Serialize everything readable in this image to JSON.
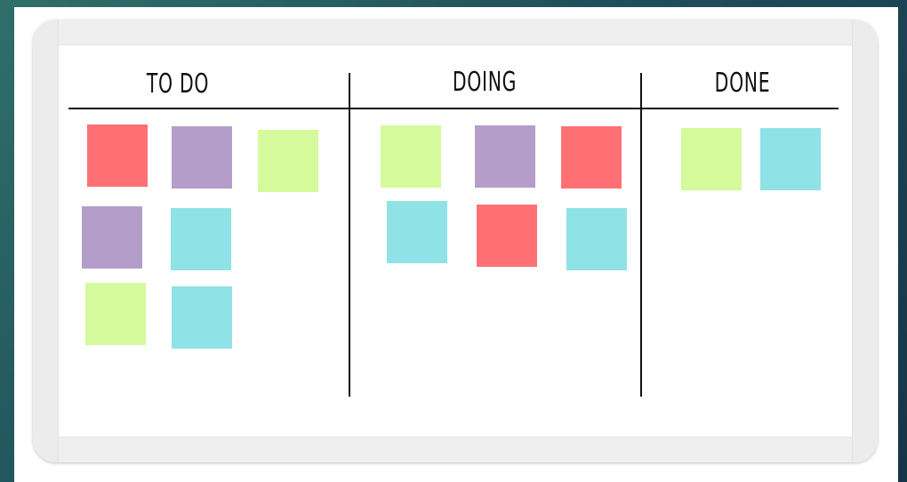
{
  "board": {
    "columns": [
      {
        "title": "TO DO",
        "notes": [
          "red",
          "purple",
          "green",
          "purple",
          "cyan",
          "green",
          "cyan"
        ]
      },
      {
        "title": "DOING",
        "notes": [
          "green",
          "purple",
          "red",
          "cyan",
          "red",
          "cyan"
        ]
      },
      {
        "title": "DONE",
        "notes": [
          "green",
          "cyan"
        ]
      }
    ]
  },
  "colors": {
    "red": "#ff7075",
    "purple": "#b49ec9",
    "green": "#d4fa9b",
    "cyan": "#8fe2e6"
  }
}
